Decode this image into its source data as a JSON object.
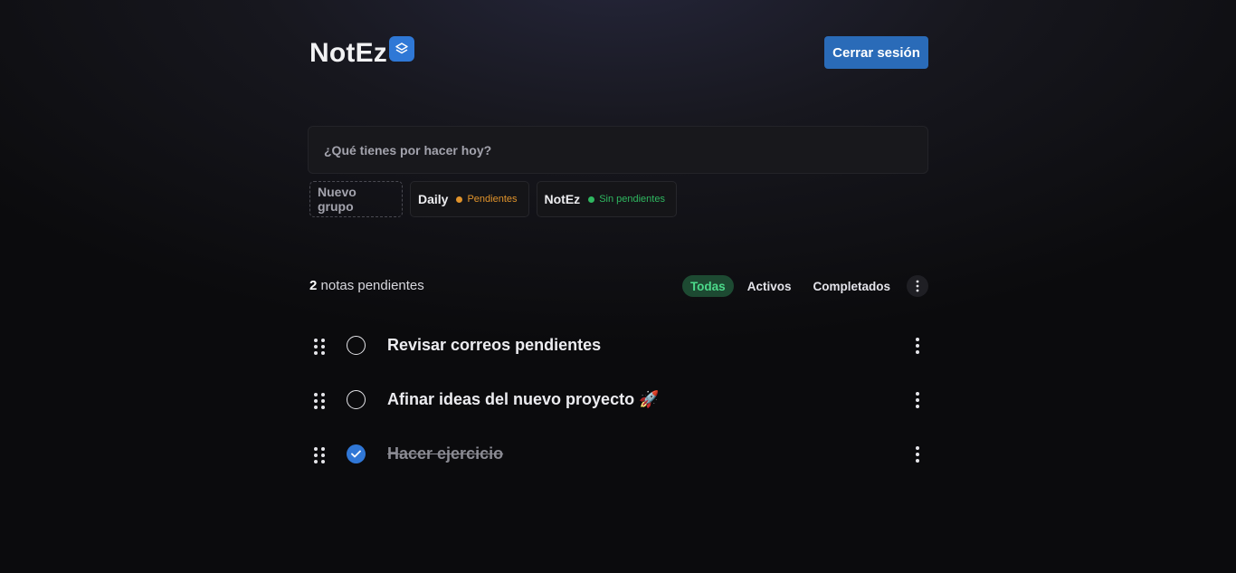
{
  "app": {
    "name": "NotEz",
    "logout_label": "Cerrar sesión"
  },
  "new_task": {
    "placeholder": "¿Qué tienes por hacer hoy?",
    "value": ""
  },
  "groups": {
    "new_label": "Nuevo grupo",
    "items": [
      {
        "name": "Daily",
        "status": "Pendientes",
        "status_color": "#e0932b"
      },
      {
        "name": "NotEz",
        "status": "Sin pendientes",
        "status_color": "#2fb760"
      }
    ]
  },
  "summary": {
    "count": "2",
    "label": "notas pendientes"
  },
  "filters": {
    "all": "Todas",
    "active": "Activos",
    "completed": "Completados",
    "selected": "Todas"
  },
  "tasks": [
    {
      "text": "Revisar correos pendientes",
      "completed": false
    },
    {
      "text": "Afinar ideas del nuevo proyecto 🚀",
      "completed": false
    },
    {
      "text": "Hacer ejercicio",
      "completed": true
    }
  ],
  "colors": {
    "accent": "#2a6bb8",
    "check_done": "#3077d6",
    "filter_active_bg": "#1d4a32",
    "filter_active_text": "#4cd98a"
  },
  "icons": {
    "logo": "layers-icon",
    "drag": "drag-handle-icon",
    "check": "checkmark-icon",
    "menu": "more-vertical-icon"
  }
}
